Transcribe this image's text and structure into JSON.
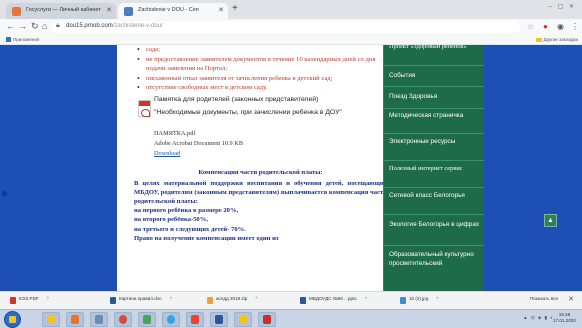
{
  "browser": {
    "tabs": [
      {
        "title": "Госуслуги — Личный кабинет",
        "active": false
      },
      {
        "title": "Zachislenie v DOU - Ceп",
        "active": true
      }
    ],
    "new_tab_label": "+",
    "window_controls": "–  ▢  ✕",
    "url_domain": "dou15.prnob.com",
    "url_path": "/zachislenie-v-dou/",
    "bookmarks": {
      "apps_label": "Приложения",
      "other_label": "Другие закладки"
    }
  },
  "content": {
    "reasons": [
      "сада;",
      "не предоставление заявителем документов в течение 10 календарных дней со дня подачи заявления на Портал;",
      "письменный отказ заявителя от зачисления ребенка в детский сад;",
      "отсутствие свободных мест в детском саду."
    ],
    "file": {
      "title": "Памятка для родителей (законных представителей)",
      "subtitle": "\"Необходимые документы, при зачислении ребенка в ДОУ\"",
      "filename": "ПАМЯТКА.pdf",
      "meta": "Adobe Acrobat Document 10.9 KB",
      "download_label": "Download"
    },
    "compensation": {
      "heading": "Компенсация части родительской платы:",
      "paragraph": "В целях материальной поддержки воспитания и обучения детей, посещающих МБДОУ, родителям (законным представителям) выплачивается компенсация части родительской платы:",
      "lines": [
        "на первого ребёнка в размере 20%,",
        "на второго ребёнка-50%,",
        "на третьего и следующих детей- 70%.",
        "Право на получение компенсации имеет один из"
      ]
    }
  },
  "sidebar": {
    "items": [
      "Проект «Здоровый ребенок»",
      "События",
      "Поезд Здоровья",
      "Методическая страничка",
      "Электронные ресурсы",
      "Полезный интернет сервис",
      "Сетевой класс Белогорья",
      "Экология Белогорья в цифрах",
      "Образовательный культурно просветительский"
    ]
  },
  "scroll_top_label": "▲",
  "downloads": {
    "items": [
      {
        "name": "КЭЭ.PDF",
        "color": "#d0342c"
      },
      {
        "name": "Картина правил.doc",
        "color": "#2b5797"
      },
      {
        "name": "аспдд 2019.zip",
        "color": "#e8a33a"
      },
      {
        "name": "МБДОУДС №66 ...pptx",
        "color": "#2b5797"
      },
      {
        "name": "15 (2).jpg",
        "color": "#3c8dcb"
      }
    ],
    "show_all_label": "Показать все",
    "close_label": "✕"
  },
  "taskbar": {
    "apps": [
      "explorer",
      "media-player",
      "file-manager",
      "chrome",
      "paint",
      "skype",
      "yandex",
      "word",
      "yandex-browser",
      "pdf"
    ],
    "tray_text": "▲ ⊡ ◈ ▮ ◐",
    "time": "15:46",
    "date": "17.01.2020"
  },
  "colors": {
    "page_side_blue": "#1e4fb6",
    "sidebar_green": "#1e6b4a",
    "reason_red": "#c0392b",
    "compensation_blue": "#1b2f8c",
    "link_blue": "#1a56b5"
  }
}
